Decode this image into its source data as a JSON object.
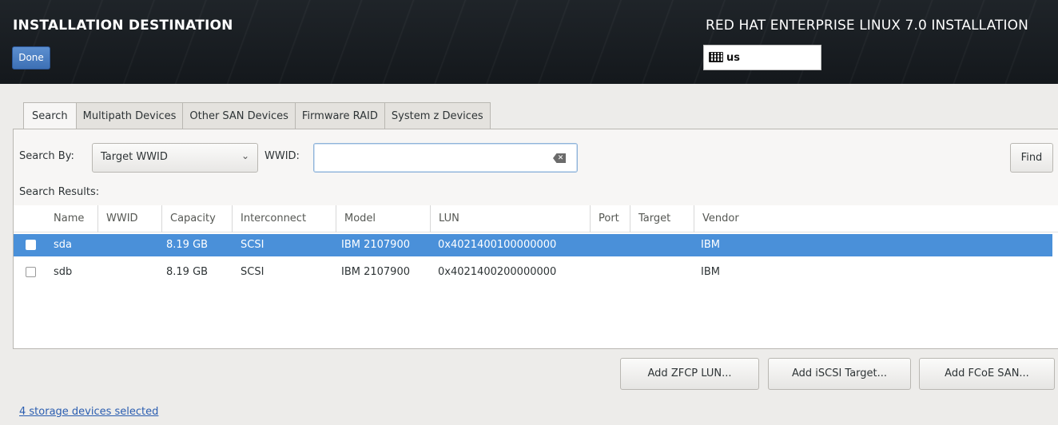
{
  "header": {
    "spoke_title": "INSTALLATION DESTINATION",
    "done_label": "Done",
    "product_title": "RED HAT ENTERPRISE LINUX 7.0 INSTALLATION",
    "keyboard_layout": "us",
    "keyboard_icon": "keyboard-icon"
  },
  "tabs": [
    {
      "label": "Search",
      "active": true
    },
    {
      "label": "Multipath Devices",
      "active": false
    },
    {
      "label": "Other SAN Devices",
      "active": false
    },
    {
      "label": "Firmware RAID",
      "active": false
    },
    {
      "label": "System z Devices",
      "active": false
    }
  ],
  "search": {
    "search_by_label": "Search By:",
    "search_by_value": "Target WWID",
    "wwid_label": "WWID:",
    "wwid_value": "",
    "clear_icon": "clear-text-icon",
    "find_label": "Find",
    "results_label": "Search Results:"
  },
  "table": {
    "columns": [
      "Name",
      "WWID",
      "Capacity",
      "Interconnect",
      "Model",
      "LUN",
      "Port",
      "Target",
      "Vendor"
    ],
    "rows": [
      {
        "checked": false,
        "selected": true,
        "name": "sda",
        "wwid": "",
        "capacity": "8.19 GB",
        "interconnect": "SCSI",
        "model": "IBM 2107900",
        "lun": "0x4021400100000000",
        "port": "",
        "target": "",
        "vendor": "IBM"
      },
      {
        "checked": false,
        "selected": false,
        "name": "sdb",
        "wwid": "",
        "capacity": "8.19 GB",
        "interconnect": "SCSI",
        "model": "IBM 2107900",
        "lun": "0x4021400200000000",
        "port": "",
        "target": "",
        "vendor": "IBM"
      }
    ]
  },
  "actions": {
    "add_zfcp": "Add ZFCP LUN...",
    "add_iscsi": "Add iSCSI Target...",
    "add_fcoe": "Add FCoE SAN..."
  },
  "footer": {
    "selected_link": "4 storage devices selected"
  },
  "colors": {
    "header_bg": "#181d21",
    "selection": "#4a90d9",
    "done_button": "#4a7fc4",
    "link": "#2a5db0"
  }
}
